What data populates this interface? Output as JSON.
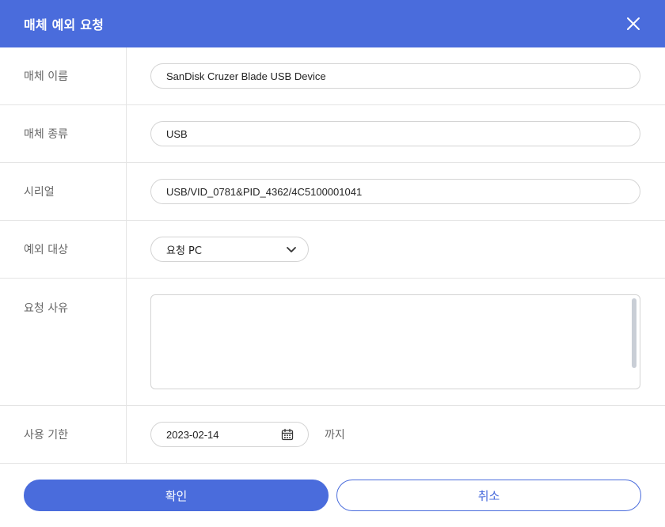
{
  "dialog": {
    "title": "매체 예외 요청",
    "close_icon": "close-icon"
  },
  "fields": {
    "media_name": {
      "label": "매체 이름",
      "value": "SanDisk Cruzer Blade USB Device"
    },
    "media_type": {
      "label": "매체 종류",
      "value": "USB"
    },
    "serial": {
      "label": "시리얼",
      "value": "USB/VID_0781&PID_4362/4C5100001041"
    },
    "target": {
      "label": "예외 대상",
      "selected": "요청 PC",
      "icon": "chevron-down-icon"
    },
    "reason": {
      "label": "요청 사유",
      "value": ""
    },
    "expiry": {
      "label": "사용 기한",
      "date": "2023-02-14",
      "suffix": "까지",
      "icon": "calendar-icon"
    }
  },
  "buttons": {
    "confirm": "확인",
    "cancel": "취소"
  },
  "colors": {
    "accent": "#4a6cdc",
    "border": "#d4d4d4",
    "divider": "#e4e4e4"
  }
}
